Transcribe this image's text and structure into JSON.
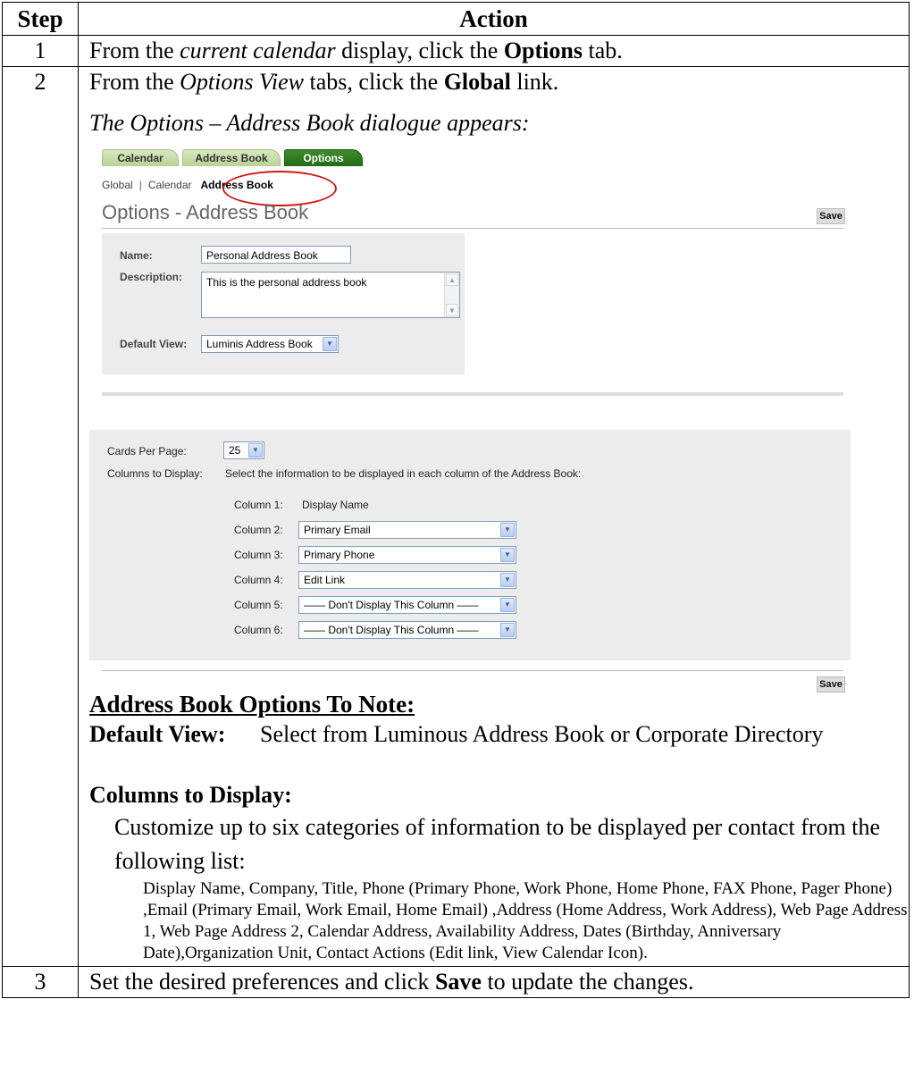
{
  "table": {
    "header_step": "Step",
    "header_action": "Action"
  },
  "step1": {
    "num": "1",
    "pre": "From the ",
    "italic": "current calendar",
    "mid": " display, click the ",
    "bold": "Options",
    "post": " tab."
  },
  "step2": {
    "num": "2",
    "pre": "From the ",
    "italic": "Options View",
    "mid": " tabs, click the ",
    "bold": "Global",
    "post": " link.",
    "dialog_caption": "The Options – Address Book dialogue appears:"
  },
  "screenshot": {
    "tabs": [
      "Calendar",
      "Address Book",
      "Options"
    ],
    "subnav": {
      "global": "Global",
      "separator": "|",
      "calendar": "Calendar",
      "address_book": "Address Book"
    },
    "heading": "Options - Address Book",
    "save_label": "Save",
    "name_label": "Name:",
    "name_value": "Personal Address Book",
    "description_label": "Description:",
    "description_value": "This is the personal address book",
    "default_view_label": "Default View:",
    "default_view_value": "Luminis Address Book",
    "cards_label": "Cards Per Page:",
    "cards_value": "25",
    "columns_label": "Columns to Display:",
    "columns_hint": "Select the information to be displayed in each column of the Address Book:",
    "columns": [
      {
        "label": "Column 1:",
        "value": "Display Name"
      },
      {
        "label": "Column 2:",
        "value": "Primary Email"
      },
      {
        "label": "Column 3:",
        "value": "Primary Phone"
      },
      {
        "label": "Column 4:",
        "value": "Edit Link"
      },
      {
        "label": "Column 5:",
        "value": "—— Don't Display This Column ——"
      },
      {
        "label": "Column 6:",
        "value": "—— Don't Display This Column ——"
      }
    ]
  },
  "notes": {
    "title": "Address Book Options To Note:",
    "default_view_term": "Default View:",
    "default_view_desc": "Select from Luminous Address Book or Corporate Directory",
    "columns_term": "Columns to Display:",
    "columns_desc": "Customize up to six categories of information to be displayed per contact from the following list:",
    "columns_list": "Display Name, Company, Title, Phone (Primary Phone, Work Phone, Home Phone, FAX Phone, Pager Phone) ,Email (Primary Email, Work Email, Home Email) ,Address (Home Address, Work Address), Web Page Address 1, Web Page Address 2, Calendar Address, Availability Address, Dates (Birthday, Anniversary Date),Organization Unit, Contact Actions (Edit link, View Calendar Icon)."
  },
  "step3": {
    "num": "3",
    "pre": "Set the desired preferences and click ",
    "bold": "Save",
    "post": " to update the changes."
  }
}
